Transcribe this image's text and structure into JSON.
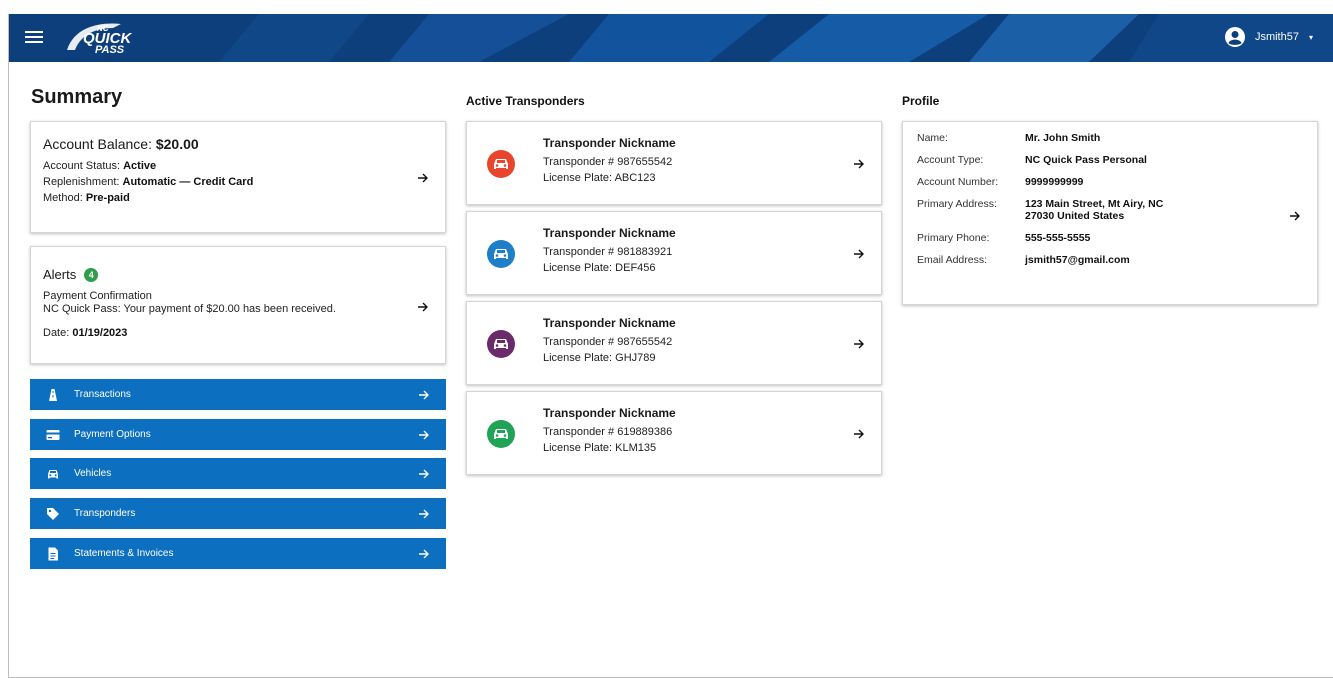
{
  "header": {
    "logo_top": "NC",
    "logo_mid": "QUICK",
    "logo_bottom": "PASS",
    "username": "Jsmith57"
  },
  "colors": {
    "header_bg": "#0d3f7d",
    "nav_btn": "#0d6fbf",
    "badge": "#2e9e4b",
    "car_red": "#e8452c",
    "car_blue": "#1e7fc9",
    "car_purple": "#6b2a6b",
    "car_green": "#21a357"
  },
  "summary": {
    "title": "Summary",
    "account": {
      "balance_label": "Account Balance:",
      "balance_value": "$20.00",
      "status_label": "Account Status:",
      "status_value": "Active",
      "replenish_label": "Replenishment:",
      "replenish_value": "Automatic — Credit Card",
      "method_label": "Method:",
      "method_value": "Pre-paid"
    },
    "alerts": {
      "label": "Alerts",
      "count": "4",
      "line1": "Payment Confirmation",
      "line2": "NC Quick Pass: Your payment of $20.00 has been received.",
      "date_label": "Date:",
      "date_value": "01/19/2023"
    },
    "nav": [
      {
        "label": "Transactions",
        "icon": "road-icon"
      },
      {
        "label": "Payment Options",
        "icon": "credit-card-icon"
      },
      {
        "label": "Vehicles",
        "icon": "car-icon"
      },
      {
        "label": "Transponders",
        "icon": "tag-icon"
      },
      {
        "label": "Statements & Invoices",
        "icon": "document-icon"
      }
    ]
  },
  "transponders": {
    "title": "Active Transponders",
    "items": [
      {
        "name": "Transponder Nickname",
        "number_label": "Transponder #",
        "number": "987655542",
        "plate_label": "License Plate:",
        "plate": "ABC123",
        "color": "#e8452c"
      },
      {
        "name": "Transponder Nickname",
        "number_label": "Transponder #",
        "number": "981883921",
        "plate_label": "License Plate:",
        "plate": "DEF456",
        "color": "#1e7fc9"
      },
      {
        "name": "Transponder Nickname",
        "number_label": "Transponder #",
        "number": "987655542",
        "plate_label": "License Plate:",
        "plate": "GHJ789",
        "color": "#6b2a6b"
      },
      {
        "name": "Transponder Nickname",
        "number_label": "Transponder #",
        "number": "619889386",
        "plate_label": "License Plate:",
        "plate": "KLM135",
        "color": "#21a357"
      }
    ]
  },
  "profile": {
    "title": "Profile",
    "fields": [
      {
        "label": "Name:",
        "value": "Mr. John Smith"
      },
      {
        "label": "Account Type:",
        "value": "NC Quick Pass Personal"
      },
      {
        "label": "Account Number:",
        "value": "9999999999"
      },
      {
        "label": "Primary Address:",
        "value": "123 Main Street, Mt Airy, NC",
        "value2": "27030 United States"
      },
      {
        "label": "Primary Phone:",
        "value": "555-555-5555"
      },
      {
        "label": "Email Address:",
        "value": "jsmith57@gmail.com"
      }
    ]
  }
}
